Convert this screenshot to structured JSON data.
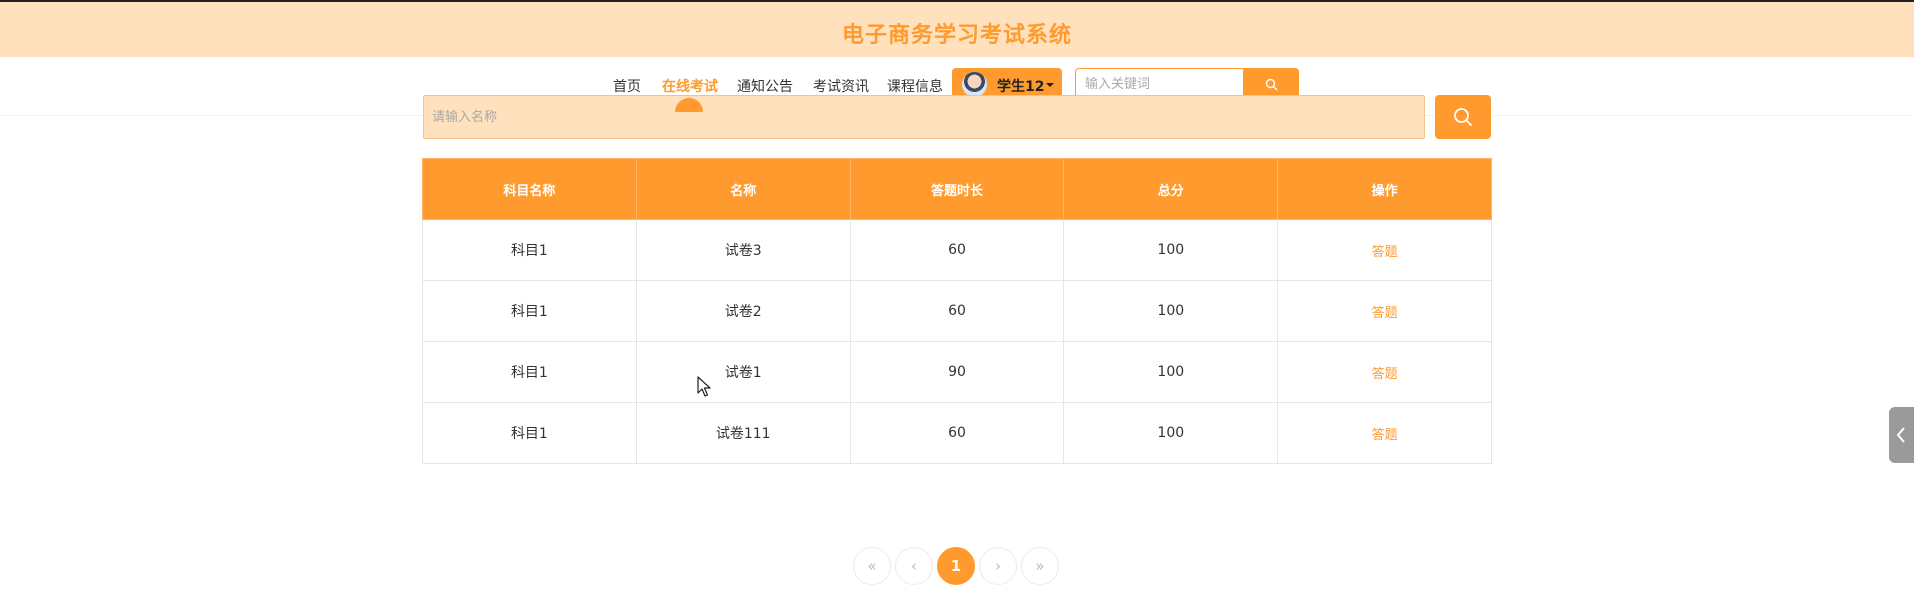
{
  "header": {
    "site_title": "电子商务学习考试系统"
  },
  "nav": {
    "items": [
      {
        "label": "首页",
        "active": false
      },
      {
        "label": "在线考试",
        "active": true
      },
      {
        "label": "通知公告",
        "active": false
      },
      {
        "label": "考试资讯",
        "active": false
      },
      {
        "label": "课程信息",
        "active": false
      }
    ],
    "user": {
      "name": "学生12"
    },
    "keyword_search": {
      "placeholder": "输入关键词",
      "icon": "search-icon"
    }
  },
  "filter": {
    "placeholder": "请输入名称",
    "button_icon": "search-icon"
  },
  "table": {
    "columns": [
      "科目名称",
      "名称",
      "答题时长",
      "总分",
      "操作"
    ],
    "rows": [
      {
        "subject": "科目1",
        "name": "试卷3",
        "duration": "60",
        "total": "100",
        "action": "答题"
      },
      {
        "subject": "科目1",
        "name": "试卷2",
        "duration": "60",
        "total": "100",
        "action": "答题"
      },
      {
        "subject": "科目1",
        "name": "试卷1",
        "duration": "90",
        "total": "100",
        "action": "答题"
      },
      {
        "subject": "科目1",
        "name": "试卷111",
        "duration": "60",
        "total": "100",
        "action": "答题"
      }
    ]
  },
  "pagination": {
    "first": "«",
    "prev": "‹",
    "current": "1",
    "next": "›",
    "last": "»"
  },
  "colors": {
    "accent": "#ff9a2e",
    "header_bg": "#ffe1bd",
    "side_tab": "#9a9a9a"
  }
}
